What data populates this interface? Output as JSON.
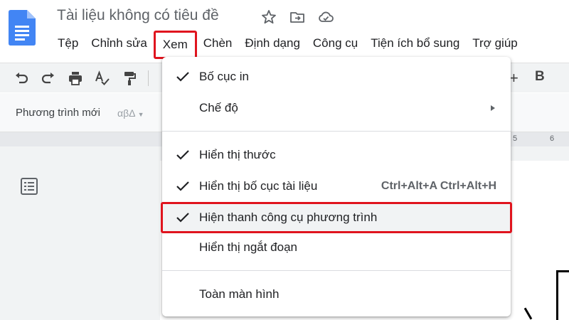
{
  "app": {
    "title": "Tài liệu không có tiêu đề",
    "title_icons": [
      "star-icon",
      "move-to-folder-icon",
      "cloud-status-icon"
    ]
  },
  "menubar": {
    "items": [
      "Tệp",
      "Chỉnh sửa",
      "Xem",
      "Chèn",
      "Định dạng",
      "Công cụ",
      "Tiện ích bổ sung",
      "Trợ giúp"
    ],
    "active": "Xem"
  },
  "toolbar": {
    "icons": [
      "undo-icon",
      "redo-icon",
      "print-icon",
      "spellcheck-icon",
      "paint-format-icon"
    ],
    "right_partial": [
      "+",
      "B"
    ]
  },
  "equation_bar": {
    "new_equation_label": "Phương trình mới",
    "greek_label": "αβΔ"
  },
  "ruler": {
    "numbers": [
      "5",
      "6"
    ]
  },
  "view_menu": {
    "items": [
      {
        "label": "Bố cục in",
        "checked": true
      },
      {
        "label": "Chế độ",
        "submenu": true
      },
      {
        "label": "Hiển thị thước",
        "checked": true
      },
      {
        "label": "Hiển thị bố cục tài liệu",
        "checked": true,
        "shortcut": "Ctrl+Alt+A Ctrl+Alt+H"
      },
      {
        "label": "Hiện thanh công cụ phương trình",
        "checked": true,
        "highlighted": true
      },
      {
        "label": "Hiển thị ngắt đoạn",
        "checked": false
      },
      {
        "label": "Toàn màn hình",
        "checked": false
      }
    ]
  },
  "colors": {
    "highlight_red": "#e0141e",
    "docs_blue": "#4285f4"
  }
}
